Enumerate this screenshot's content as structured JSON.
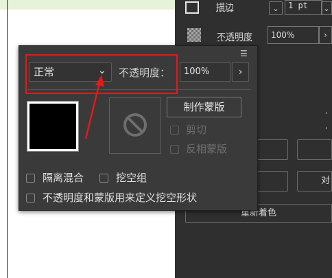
{
  "background_panel": {
    "stroke_label": "描边",
    "stroke_weight": "1 pt",
    "opacity_label": "不透明度",
    "opacity_value": "100%",
    "side_button_text": "对",
    "recolor_button": "重新着色"
  },
  "popup": {
    "blend_mode": "正常",
    "opacity_label": "不透明度：",
    "opacity_value": "100%",
    "make_mask_button": "制作蒙版",
    "clip_label": "剪切",
    "invert_mask_label": "反相蒙版",
    "isolate_blending_label": "隔离混合",
    "knockout_group_label": "挖空组",
    "opacity_mask_knockout_label": "不透明度和蒙版用来定义挖空形状"
  },
  "colors": {
    "annotation_red": "#e01b1b",
    "panel_dark": "#2f2f2f",
    "popup_bg": "#3a3a3a"
  },
  "icons": [
    "panel-menu-icon",
    "chevron-down-icon",
    "chevron-right-icon",
    "no-mask-icon",
    "opacity-checker-icon",
    "stroke-swatch-icon"
  ]
}
